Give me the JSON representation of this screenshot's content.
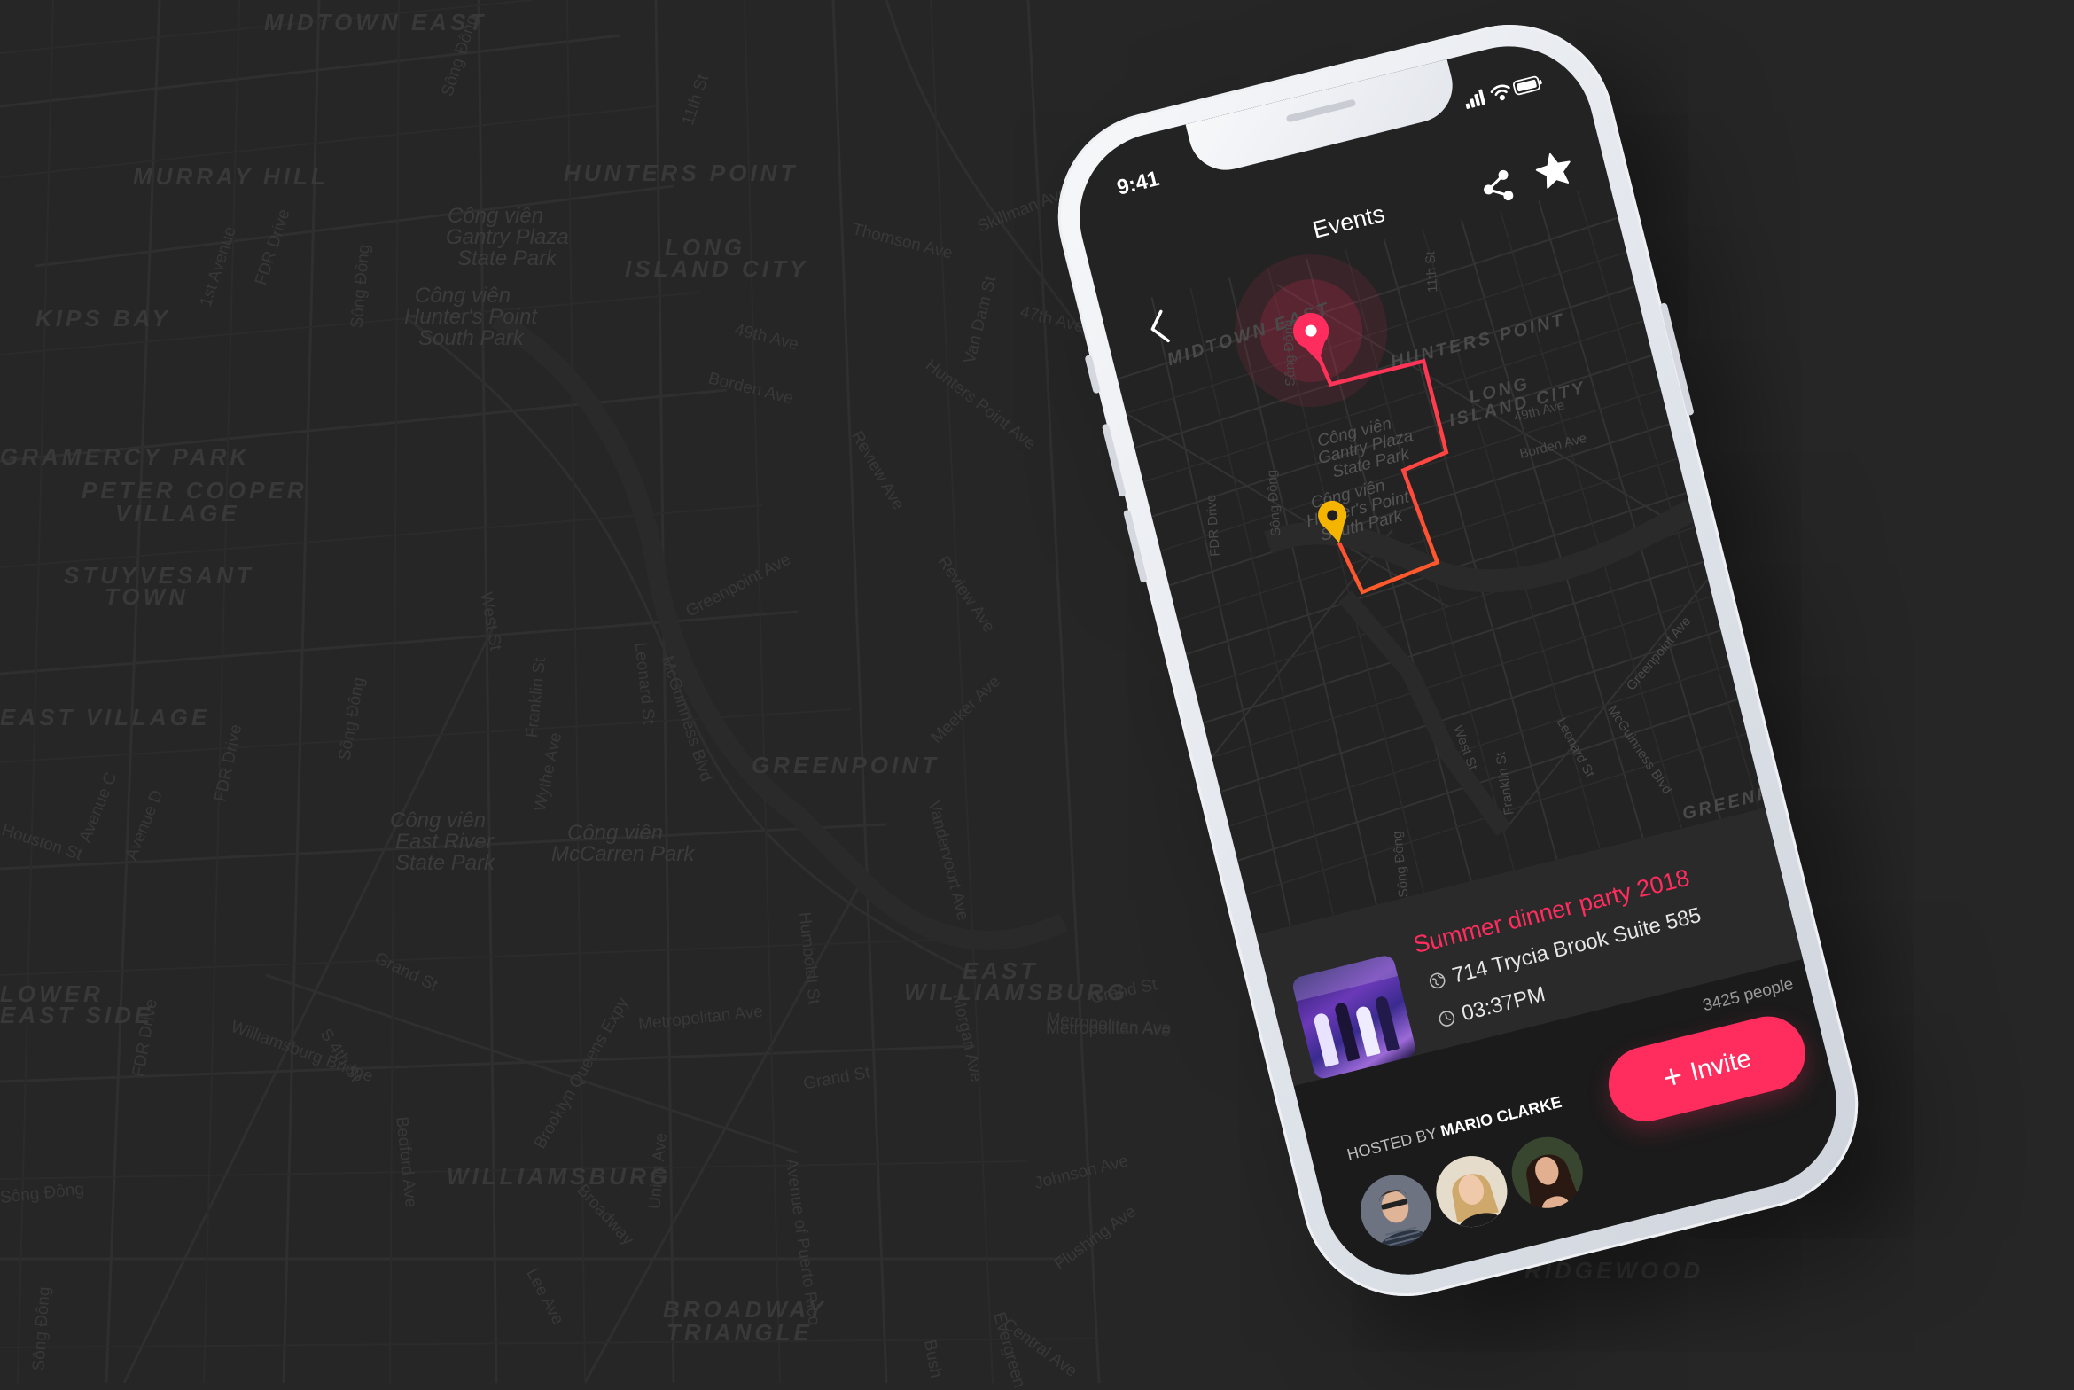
{
  "background": {
    "districts": [
      "MIDTOWN EAST",
      "HUNTERS POINT",
      "LONG",
      "ISLAND CITY",
      "MURRAY HILL",
      "KIPS BAY",
      "GRAMERCY PARK",
      "PETER COOPER",
      "VILLAGE",
      "STUYVESANT",
      "TOWN",
      "EAST VILLAGE",
      "GREENPOINT",
      "EAST",
      "WILLIAMSBURG",
      "WILLIAMSBURG",
      "LOWER",
      "EAST SIDE",
      "BROADWAY",
      "TRIANGLE",
      "RIDGEWOOD"
    ],
    "parks": [
      "Công viên",
      "Gantry Plaza",
      "State Park",
      "Công viên",
      "Hunter's Point",
      "South Park",
      "Công viên",
      "East River",
      "State Park",
      "Công viên",
      "McCarren Park"
    ],
    "streets": [
      "Sông Đông",
      "11th St",
      "Thomson Ave",
      "Skillman Ave",
      "49th Ave",
      "Borden Ave",
      "47th Ave",
      "Van Dam St",
      "Hunters Point Ave",
      "Review Ave",
      "FDR Drive",
      "1st Avenue",
      "Sông Đông",
      "West St",
      "Franklin St",
      "Leonard St",
      "McGuinness Blvd",
      "Greenpoint Ave",
      "Review Ave",
      "Meeker Ave",
      "Vandervoort Ave",
      "Humboldt St",
      "Morgan Ave",
      "Metropolitan Ave",
      "Metropolitan Ave",
      "Grand St",
      "Grand St",
      "Brooklyn Queens Expy",
      "Union Ave",
      "Avenue of Puerto Rico",
      "Johnson Ave",
      "Flushing Ave",
      "Williamsburg Bridge",
      "FDR Drive",
      "Metropolitan Ave",
      "Grand St",
      "Wythe Ave",
      "Sông Đông",
      "Houston St",
      "Avenue C",
      "Avenue D",
      "FDR Drive",
      "Sông Đông",
      "Bedford Ave",
      "Broadway",
      "Central Ave",
      "Lee Ave",
      "S 4th St",
      "Sông Đông",
      "Bush",
      "Evergreen"
    ]
  },
  "status_bar": {
    "time": "9:41"
  },
  "nav": {
    "title": "Events",
    "icons": [
      "back-chevron-icon",
      "share-icon",
      "star-icon"
    ]
  },
  "map": {
    "districts": [
      "MIDTOWN EAST",
      "HUNTERS POINT",
      "LONG",
      "ISLAND CITY",
      "GREENPOINT"
    ],
    "parks": [
      "Công viên",
      "Gantry Plaza",
      "State Park",
      "Công viên",
      "Hunter's Point",
      "South Park"
    ],
    "streets": [
      "Sông Đông",
      "Sông Đông",
      "FDR Drive",
      "49th Ave",
      "Borden Ave",
      "West St",
      "Franklin St",
      "Leonard St",
      "McGuinness Blvd",
      "Greenpoint Ave",
      "Sông Đông",
      "11th St"
    ],
    "colors": {
      "route_start": "#ff2d5e",
      "route_end": "#ff5a2a",
      "origin_pin": "#ff2d5e",
      "destination_pin": "#f5b400"
    }
  },
  "event": {
    "title": "Summer dinner party 2018",
    "address": "714 Trycia Brook Suite 585",
    "time": "03:37PM",
    "people_count": "3425 people",
    "hosted_by_label": "HOSTED BY",
    "host_name": "MARIO CLARKE",
    "invite_label": "Invite",
    "accent_color": "#ff2d5e"
  }
}
